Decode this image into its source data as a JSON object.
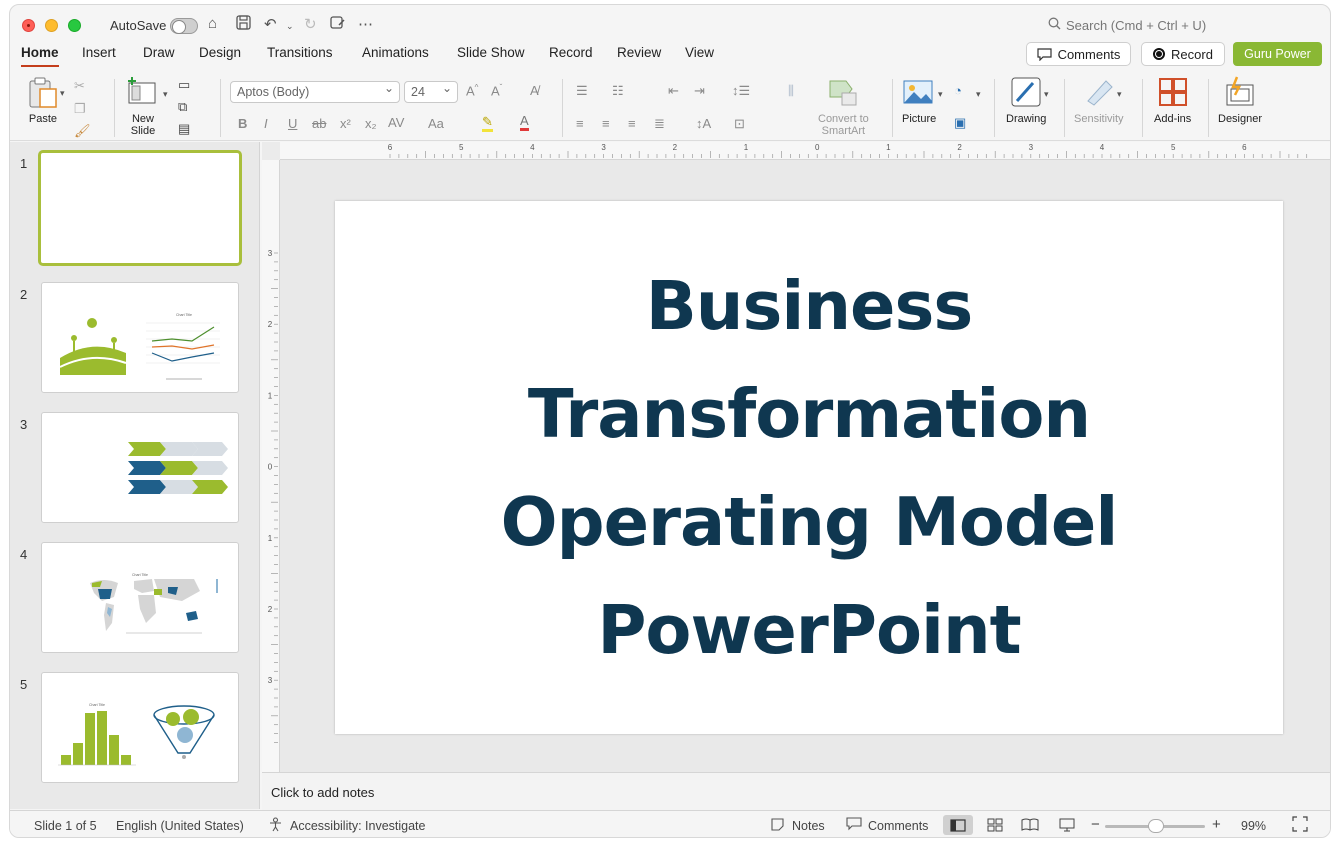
{
  "titlebar": {
    "autosave_label": "AutoSave",
    "search_placeholder": "Search (Cmd + Ctrl + U)"
  },
  "tabs": [
    {
      "label": "Home"
    },
    {
      "label": "Insert"
    },
    {
      "label": "Draw"
    },
    {
      "label": "Design"
    },
    {
      "label": "Transitions"
    },
    {
      "label": "Animations"
    },
    {
      "label": "Slide Show"
    },
    {
      "label": "Record"
    },
    {
      "label": "Review"
    },
    {
      "label": "View"
    }
  ],
  "actions": {
    "comments_label": "Comments",
    "record_label": "Record",
    "addin_label": "Guru Power"
  },
  "ribbon": {
    "paste_label": "Paste",
    "new_slide_label_1": "New",
    "new_slide_label_2": "Slide",
    "font_name": "Aptos (Body)",
    "font_size": "24",
    "smartart_label_1": "Convert to",
    "smartart_label_2": "SmartArt",
    "picture_label": "Picture",
    "drawing_label": "Drawing",
    "sensitivity_label": "Sensitivity",
    "addins_label": "Add-ins",
    "designer_label": "Designer"
  },
  "thumbnails": [
    {
      "number": "1",
      "chart_title": ""
    },
    {
      "number": "2",
      "chart_title": "Chart Title"
    },
    {
      "number": "3",
      "chart_title": ""
    },
    {
      "number": "4",
      "chart_title": "Chart Title"
    },
    {
      "number": "5",
      "chart_title": "Chart Title"
    }
  ],
  "ruler": {
    "h_labels": [
      "6",
      "5",
      "4",
      "3",
      "2",
      "1",
      "0",
      "1",
      "2",
      "3",
      "4",
      "5",
      "6"
    ],
    "v_labels": [
      "3",
      "2",
      "1",
      "0",
      "1",
      "2",
      "3"
    ]
  },
  "slide": {
    "title_line_1": "Business",
    "title_line_2": "Transformation",
    "title_line_3": "Operating Model",
    "title_line_4": "PowerPoint"
  },
  "notes_placeholder": "Click to add notes",
  "status": {
    "slide_counter": "Slide 1 of 5",
    "language": "English (United States)",
    "accessibility": "Accessibility: Investigate",
    "notes_label": "Notes",
    "comments_label": "Comments",
    "zoom_level": "99%"
  },
  "colors": {
    "accent_green": "#8ab834",
    "title_navy": "#0f3750",
    "tab_underline": "#c43e1c"
  }
}
